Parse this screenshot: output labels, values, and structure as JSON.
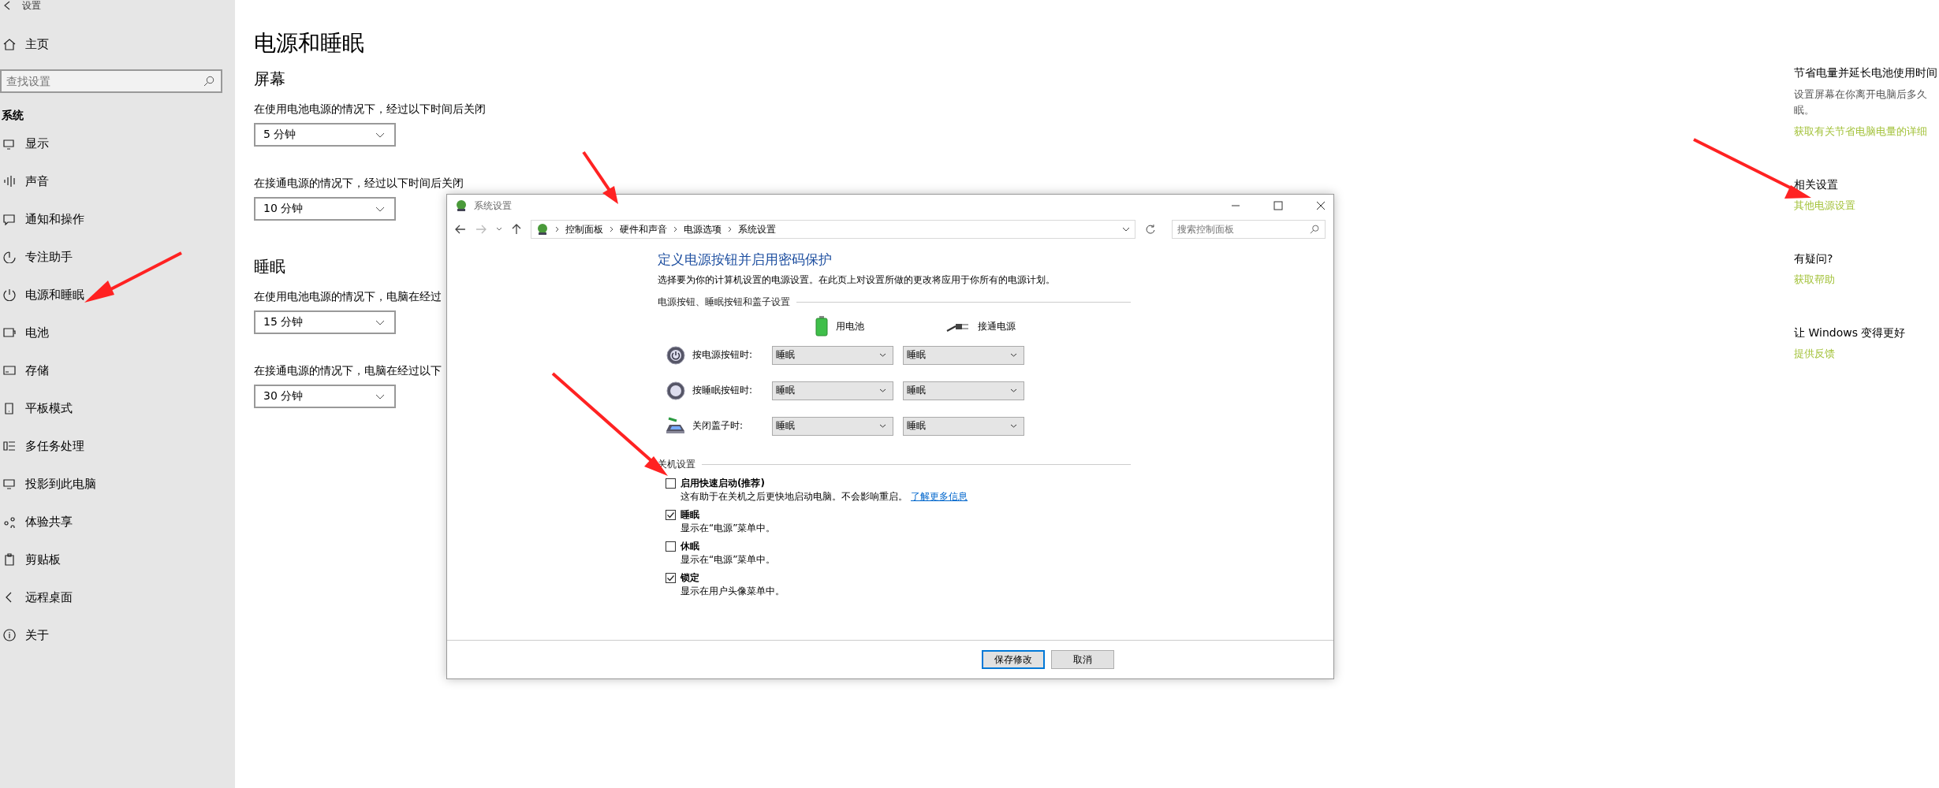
{
  "sidebar": {
    "title": "设置",
    "home": "主页",
    "search": {
      "placeholder": "查找设置"
    },
    "section": "系统",
    "items": [
      {
        "label": "显示"
      },
      {
        "label": "声音"
      },
      {
        "label": "通知和操作"
      },
      {
        "label": "专注助手"
      },
      {
        "label": "电源和睡眠"
      },
      {
        "label": "电池"
      },
      {
        "label": "存储"
      },
      {
        "label": "平板模式"
      },
      {
        "label": "多任务处理"
      },
      {
        "label": "投影到此电脑"
      },
      {
        "label": "体验共享"
      },
      {
        "label": "剪贴板"
      },
      {
        "label": "远程桌面"
      },
      {
        "label": "关于"
      }
    ]
  },
  "main": {
    "title": "电源和睡眠",
    "sections": [
      {
        "heading": "屏幕",
        "settings": [
          {
            "label": "在使用电池电源的情况下，经过以下时间后关闭",
            "value": "5 分钟"
          },
          {
            "label": "在接通电源的情况下，经过以下时间后关闭",
            "value": "10 分钟"
          }
        ]
      },
      {
        "heading": "睡眠",
        "settings": [
          {
            "label": "在使用电池电源的情况下，电脑在经过",
            "value": "15 分钟"
          },
          {
            "label": "在接通电源的情况下，电脑在经过以下",
            "value": "30 分钟"
          }
        ]
      }
    ]
  },
  "dialog": {
    "title": "系统设置",
    "breadcrumb": [
      "控制面板",
      "硬件和声音",
      "电源选项",
      "系统设置"
    ],
    "search": {
      "placeholder": "搜索控制面板"
    },
    "heading": "定义电源按钮并启用密码保护",
    "description": "选择要为你的计算机设置的电源设置。在此页上对设置所做的更改将应用于你所有的电源计划。",
    "button_section": {
      "title": "电源按钮、睡眠按钮和盖子设置",
      "columns": [
        {
          "label": "用电池",
          "kind": "battery"
        },
        {
          "label": "接通电源",
          "kind": "plug"
        }
      ],
      "rows": [
        {
          "label": "按电源按钮时:",
          "kind": "power",
          "values": [
            "睡眠",
            "睡眠"
          ]
        },
        {
          "label": "按睡眠按钮时:",
          "kind": "sleep",
          "values": [
            "睡眠",
            "睡眠"
          ]
        },
        {
          "label": "关闭盖子时:",
          "kind": "lid",
          "values": [
            "睡眠",
            "睡眠"
          ]
        }
      ]
    },
    "shutdown_section": {
      "title": "关机设置",
      "options": [
        {
          "label": "启用快速启动(推荐)",
          "checked": false,
          "description": "这有助于在关机之后更快地启动电脑。不会影响重启。",
          "link": "了解更多信息"
        },
        {
          "label": "睡眠",
          "checked": true,
          "description": "显示在“电源”菜单中。"
        },
        {
          "label": "休眠",
          "checked": false,
          "description": "显示在“电源”菜单中。"
        },
        {
          "label": "锁定",
          "checked": true,
          "description": "显示在用户头像菜单中。"
        }
      ]
    },
    "buttons": [
      {
        "label": "保存修改",
        "kind": "primary"
      },
      {
        "label": "取消",
        "kind": "secondary"
      }
    ]
  },
  "aside": {
    "sections": [
      {
        "heading": "节省电量并延长电池使用时间",
        "lines": [
          "设置屏幕在你离开电脑后多久",
          "眠。"
        ],
        "link": "获取有关节省电脑电量的详细"
      },
      {
        "heading": "相关设置",
        "link": "其他电源设置"
      },
      {
        "heading": "有疑问?",
        "link": "获取帮助"
      },
      {
        "heading": "让 Windows 变得更好",
        "link": "提供反馈"
      }
    ]
  }
}
